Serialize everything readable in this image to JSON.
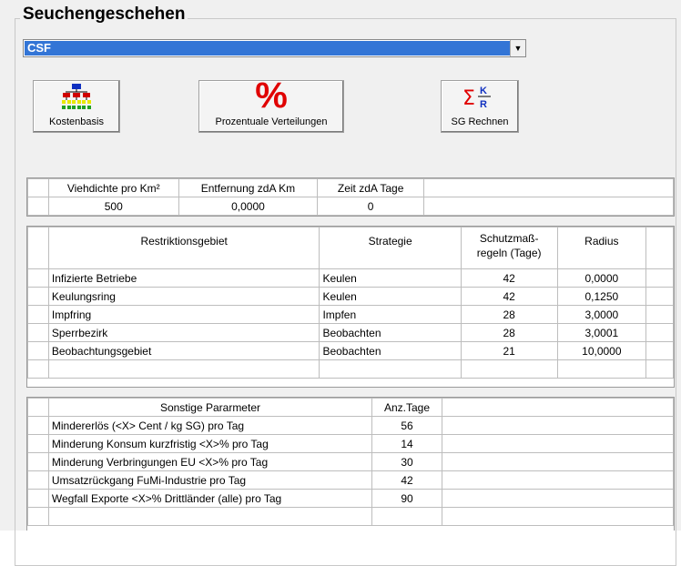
{
  "group": {
    "title": "Seuchengeschehen"
  },
  "disease_select": {
    "value": "CSF"
  },
  "toolbar": {
    "kostenbasis": "Kostenbasis",
    "prozentuale": "Prozentuale Verteilungen",
    "sg_rechnen": "SG Rechnen"
  },
  "density_table": {
    "headers": [
      "Viehdichte pro Km²",
      "Entfernung zdA Km",
      "Zeit zdA Tage"
    ],
    "values": [
      "500",
      "0,0000",
      "0"
    ]
  },
  "restriction_table": {
    "headers": [
      "Restriktionsgebiet",
      "Strategie",
      "Schutzmaß-\nregeln (Tage)",
      "Radius"
    ],
    "rows": [
      [
        "Infizierte Betriebe",
        "Keulen",
        "42",
        "0,0000"
      ],
      [
        "Keulungsring",
        "Keulen",
        "42",
        "0,1250"
      ],
      [
        "Impfring",
        "Impfen",
        "28",
        "3,0000"
      ],
      [
        "Sperrbezirk",
        "Beobachten",
        "28",
        "3,0001"
      ],
      [
        "Beobachtungsgebiet",
        "Beobachten",
        "21",
        "10,0000"
      ]
    ]
  },
  "other_table": {
    "headers": [
      "Sonstige Pararmeter",
      "Anz.Tage"
    ],
    "rows": [
      [
        "Mindererlös (<X> Cent / kg SG) pro Tag",
        "56"
      ],
      [
        "Minderung Konsum kurzfristig <X>% pro Tag",
        "14"
      ],
      [
        "Minderung Verbringungen EU <X>% pro Tag",
        "30"
      ],
      [
        "Umsatzrückgang FuMi-Industrie pro Tag",
        "42"
      ],
      [
        "Wegfall Exporte <X>% Drittländer (alle) pro Tag",
        "90"
      ]
    ]
  }
}
